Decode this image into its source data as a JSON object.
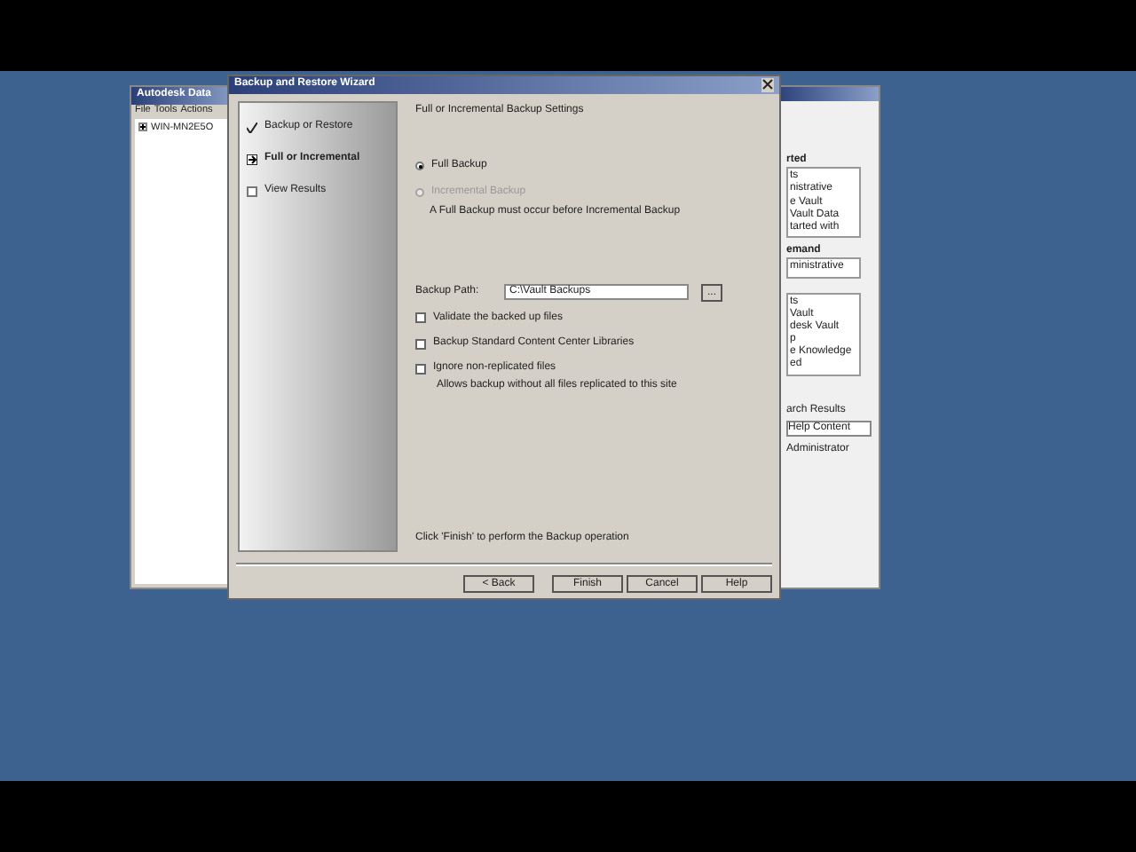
{
  "background_window": {
    "title": "Autodesk Data",
    "menu": [
      "File",
      "Tools",
      "Actions"
    ],
    "tree": [
      {
        "label": "WIN-MN2E5O",
        "expanded": false
      }
    ]
  },
  "side_panel": {
    "sections": [
      {
        "heading": "rted",
        "items": [
          "ts",
          "nistrative",
          "e Vault",
          "Vault Data",
          "tarted with"
        ]
      },
      {
        "heading": "emand",
        "items": [
          "ministrative"
        ]
      },
      {
        "items": [
          "ts",
          "Vault",
          "desk Vault",
          "p",
          "e Knowledge",
          "ed"
        ]
      }
    ],
    "search_label": "arch Results",
    "tab": "Help Content",
    "status": "Administrator"
  },
  "wizard": {
    "title": "Backup and Restore Wizard",
    "steps": [
      {
        "label": "Backup or Restore",
        "kind": "check"
      },
      {
        "label": "Full or Incremental",
        "kind": "arrow"
      },
      {
        "label": "View Results",
        "kind": "box"
      }
    ],
    "heading": "Full or Incremental Backup Settings",
    "options": [
      {
        "label": "Full Backup",
        "selected": true,
        "disabled": false
      },
      {
        "label": "Incremental Backup",
        "selected": false,
        "disabled": true
      }
    ],
    "note": "A Full Backup must occur before Incremental Backup",
    "path_label": "Backup Path:",
    "path_value": "C:\\Vault Backups",
    "browse": "...",
    "checkboxes": [
      {
        "label": "Validate the backed up files",
        "checked": false
      },
      {
        "label": "Backup Standard Content Center Libraries",
        "checked": false
      },
      {
        "label": "Ignore non-replicated files",
        "checked": false,
        "note": "Allows backup without all files replicated to this site"
      }
    ],
    "footer_text": "Click 'Finish' to perform the Backup operation",
    "buttons": [
      "< Back",
      "Finish",
      "Cancel",
      "Help"
    ]
  }
}
